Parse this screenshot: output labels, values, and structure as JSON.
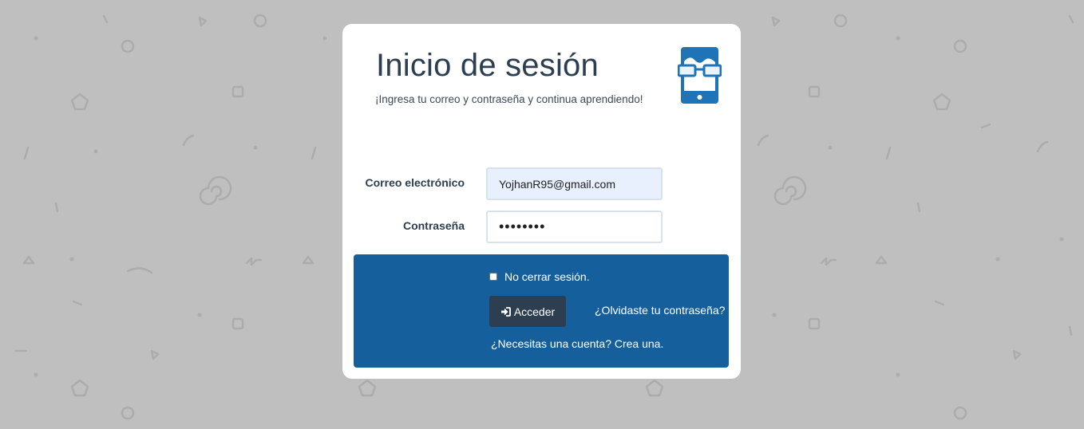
{
  "login": {
    "title": "Inicio de sesión",
    "subtitle": "¡Ingresa tu correo y contraseña y continua aprendiendo!",
    "logo_icon": "phone-with-glasses-icon",
    "email_label": "Correo electrónico",
    "email_value": "YojhanR95@gmail.com",
    "password_label": "Contraseña",
    "password_value": "••••••••",
    "remember_label": "No cerrar sesión.",
    "remember_checked": false,
    "submit_label": "Acceder",
    "submit_icon": "sign-in-icon",
    "forgot_link": "¿Olvidaste tu contraseña?",
    "signup_link": "¿Necesitas una cuenta? Crea una."
  },
  "colors": {
    "page_background": "#bfbfbf",
    "card_background": "#ffffff",
    "panel_blue": "#15609c",
    "button_dark": "#2c3e50",
    "logo_blue": "#1f73b7",
    "autofill_background": "#e8f0fe"
  }
}
